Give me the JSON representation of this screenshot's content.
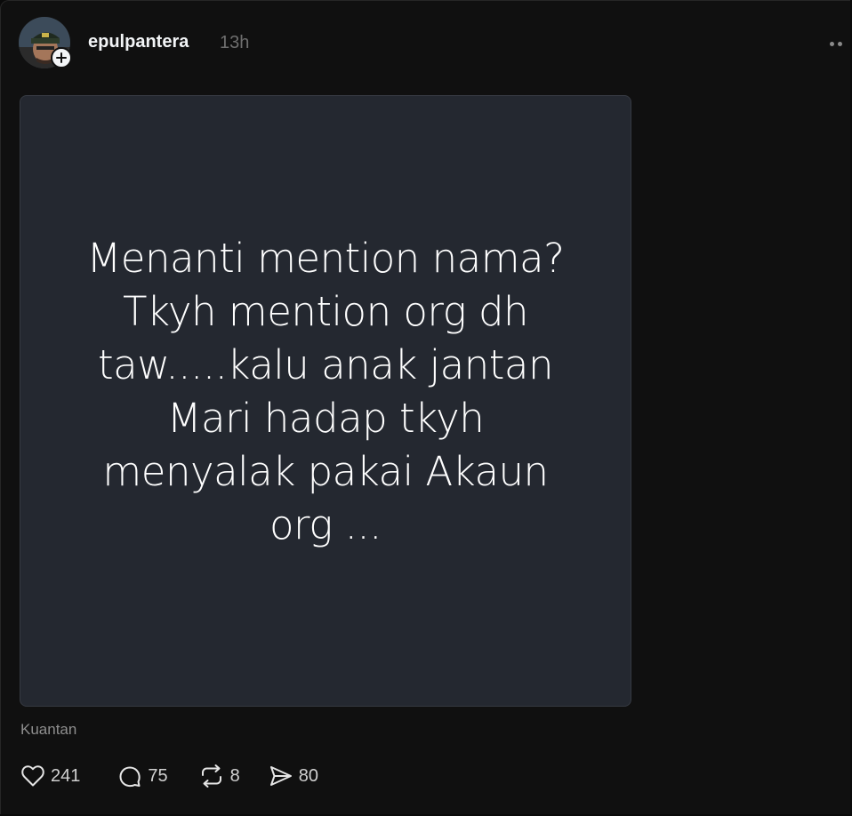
{
  "post": {
    "username": "epulpantera",
    "time_ago": "13h",
    "image_text": "Menanti mention nama? Tkyh mention org dh taw.....kalu anak jantan Mari hadap tkyh menyalak pakai Akaun org ...",
    "location": "Kuantan"
  },
  "actions": {
    "likes": "241",
    "replies": "75",
    "reposts": "8",
    "shares": "80"
  },
  "icons": {
    "avatar": "profile-photo",
    "follow": "plus-icon",
    "more": "more-dots-icon",
    "like": "heart-icon",
    "reply": "comment-bubble-icon",
    "repost": "repost-icon",
    "share": "send-icon"
  },
  "colors": {
    "background": "#101010",
    "media_background": "#242830",
    "text_primary": "#f3f5f7",
    "text_secondary": "#8e8e8e"
  }
}
